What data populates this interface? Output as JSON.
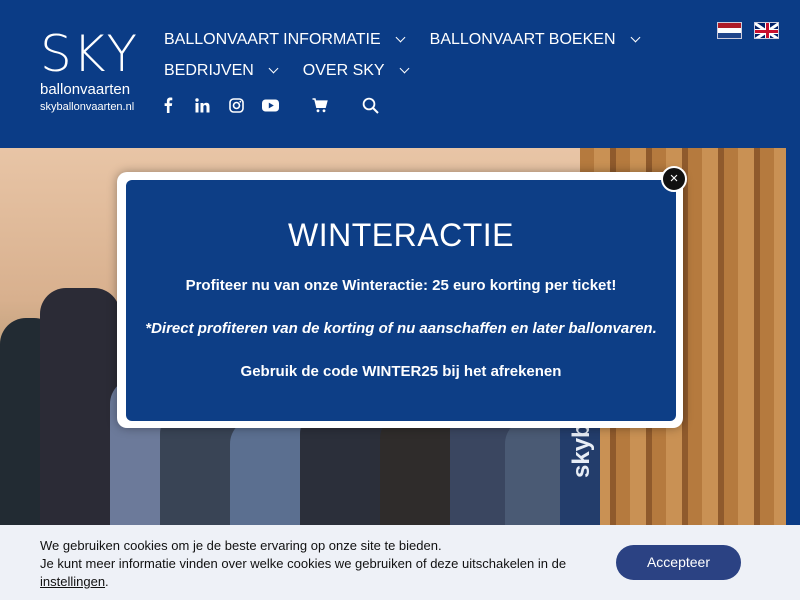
{
  "header": {
    "logo": {
      "name": "SKY",
      "sub": "ballonvaarten",
      "url": "skyballonvaarten.nl"
    },
    "nav": [
      {
        "label": "BALLONVAART INFORMATIE"
      },
      {
        "label": "BALLONVAART BOEKEN"
      },
      {
        "label": "BEDRIJVEN"
      },
      {
        "label": "OVER SKY"
      }
    ],
    "languages": [
      "nl-flag",
      "en-flag"
    ],
    "icons": [
      "facebook-icon",
      "linkedin-icon",
      "instagram-icon",
      "youtube-icon",
      "cart-icon",
      "search-icon"
    ]
  },
  "hero": {
    "balloon_text": "skybal"
  },
  "modal": {
    "title": "WINTERACTIE",
    "line1": "Profiteer nu van onze Winteractie: 25 euro korting per ticket!",
    "line2": "*Direct profiteren van de korting of nu aanschaffen en later ballonvaren.",
    "line3": "Gebruik de code WINTER25 bij het afrekenen",
    "close_symbol": "×"
  },
  "cookie": {
    "line1": "We gebruiken cookies om je de beste ervaring op onze site te bieden.",
    "line2": "Je kunt meer informatie vinden over welke cookies we gebruiken of deze uitschakelen in de",
    "link": "instellingen",
    "link_suffix": ".",
    "accept_label": "Accepteer"
  },
  "colors": {
    "header_bg": "#0b3c86",
    "modal_bg": "#0d3e86",
    "accept_bg": "#2b4283",
    "cookie_bg": "#eef1f7"
  }
}
